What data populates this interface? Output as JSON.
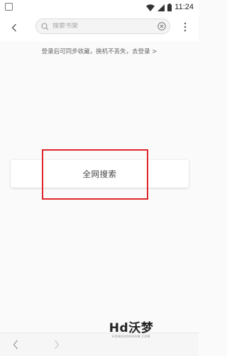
{
  "status_bar": {
    "time": "11:24"
  },
  "toolbar": {
    "search": {
      "placeholder": "搜索书架",
      "value": ""
    }
  },
  "login_tip": "登录后可同步收藏，换机不丢失，去登录 >",
  "main": {
    "search_all_label": "全网搜索"
  },
  "watermark": {
    "logo": "Hd沃梦",
    "sub": "HDWOODREAM.COM"
  },
  "colors": {
    "highlight": "#e0262d",
    "background": "#fafafa"
  }
}
